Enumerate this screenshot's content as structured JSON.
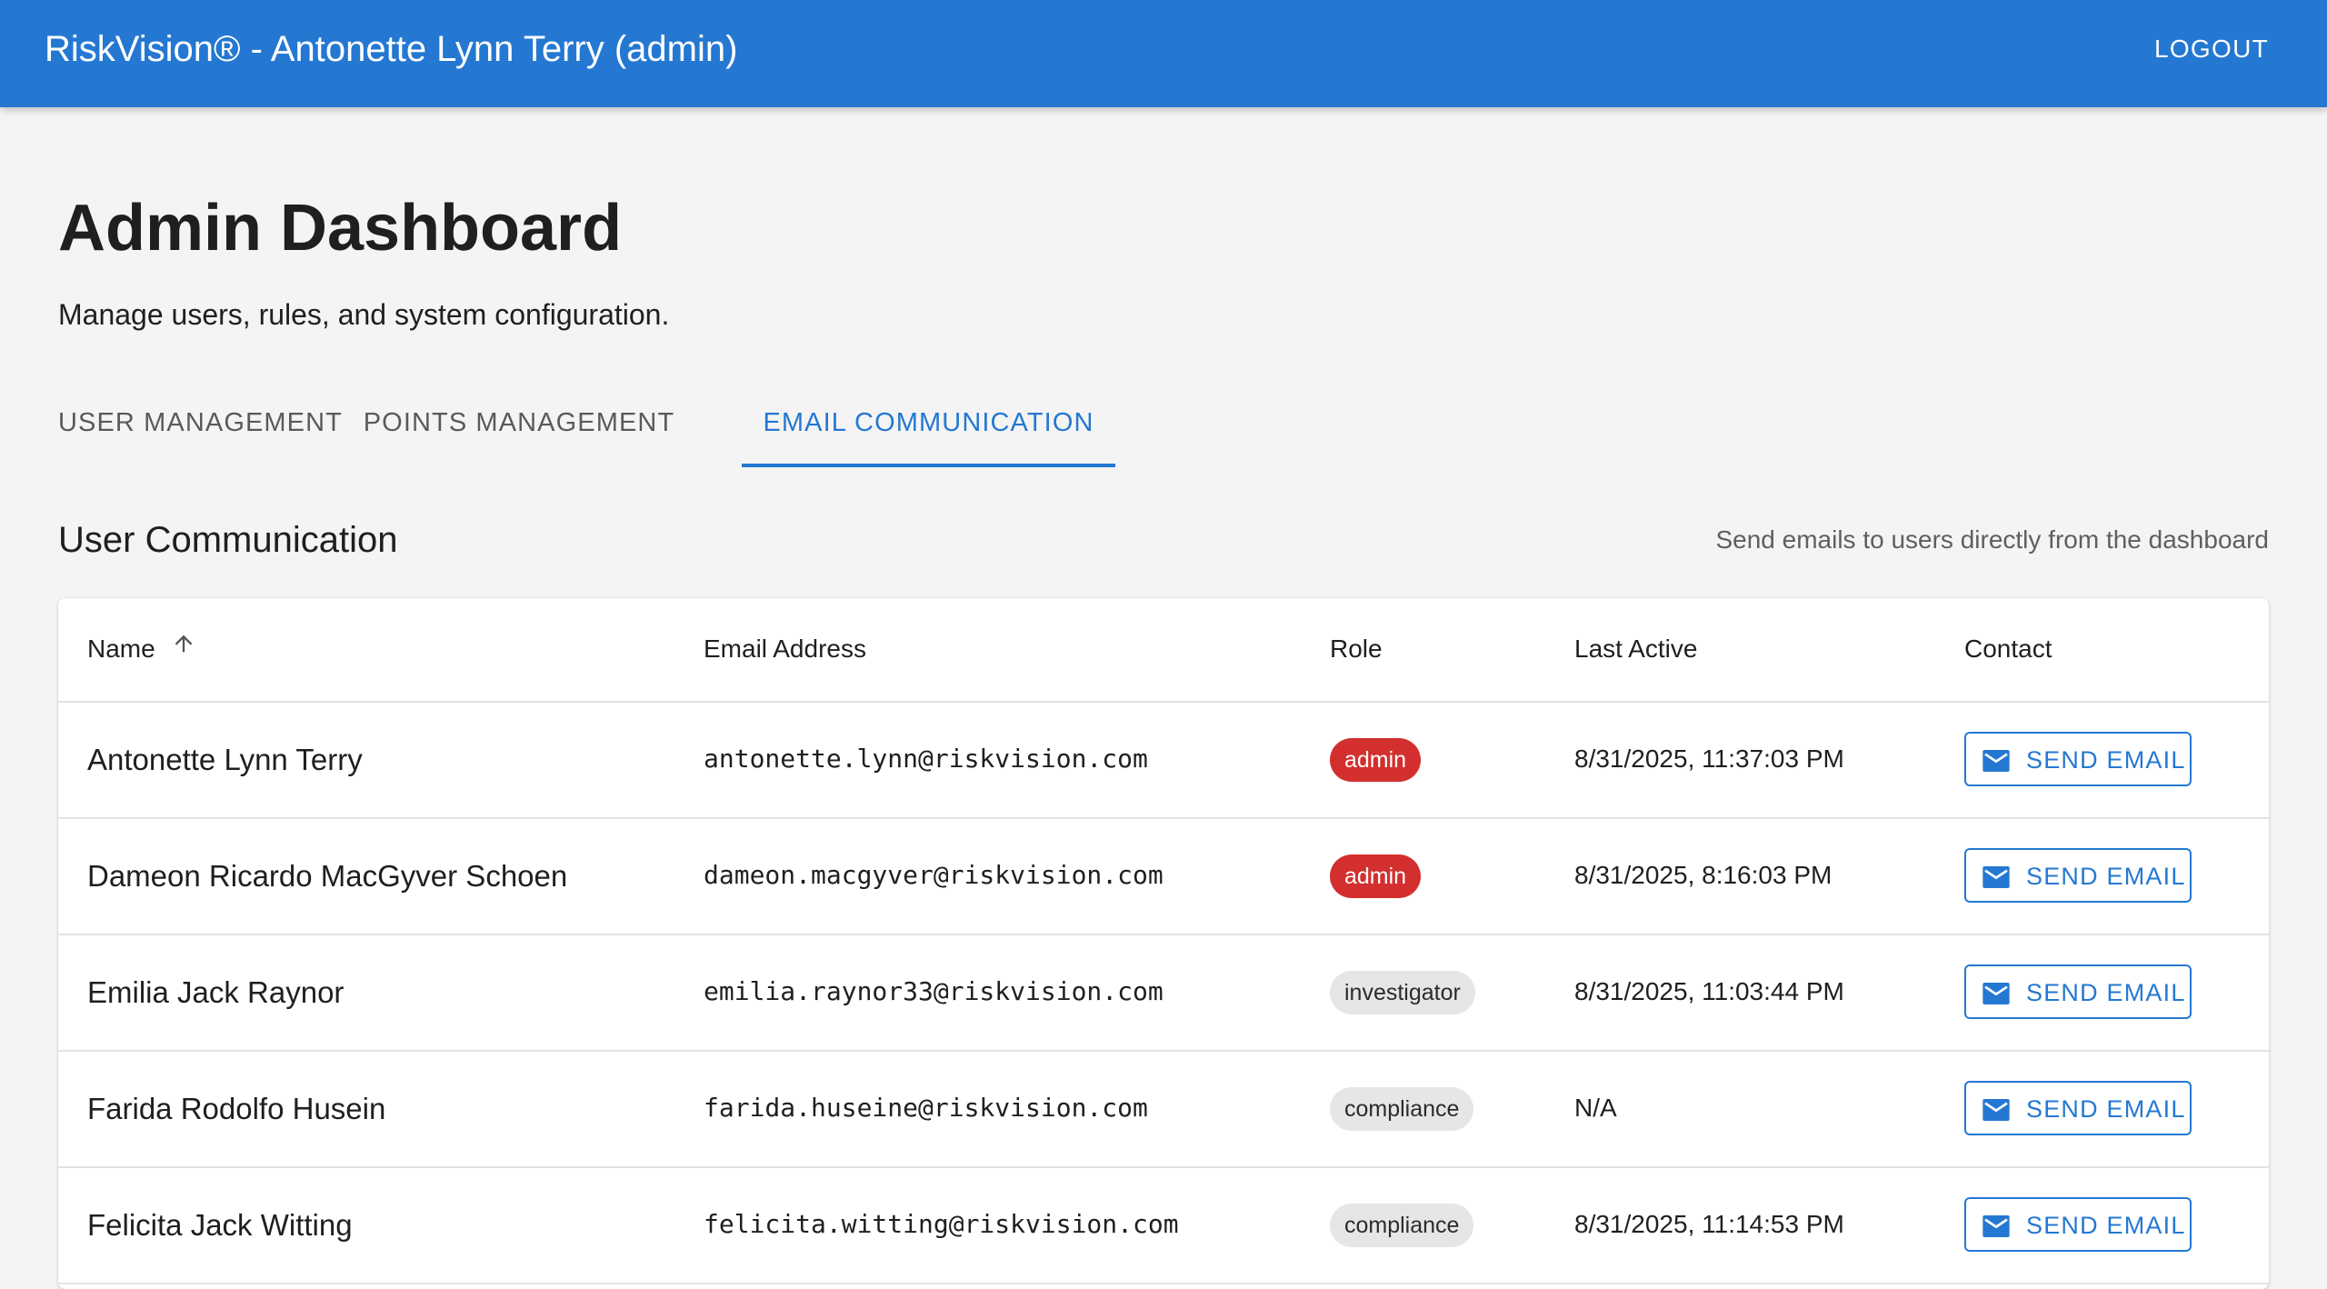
{
  "app": {
    "title": "RiskVision® - Antonette Lynn Terry (admin)",
    "logout_label": "LOGOUT",
    "brand_color": "#2478d2"
  },
  "page": {
    "title": "Admin Dashboard",
    "subtitle": "Manage users, rules, and system configuration."
  },
  "tabs": [
    {
      "label": "USER MANAGEMENT",
      "active": false
    },
    {
      "label": "POINTS MANAGEMENT",
      "active": false
    },
    {
      "label": "EMAIL COMMUNICATION",
      "active": true
    }
  ],
  "section": {
    "title": "User Communication",
    "caption": "Send emails to users directly from the dashboard"
  },
  "table": {
    "columns": {
      "name": "Name",
      "email": "Email Address",
      "role": "Role",
      "last_active": "Last Active",
      "contact": "Contact"
    },
    "sort": {
      "column": "name",
      "direction": "ascending",
      "icon": "arrow-up-icon"
    },
    "button_label": "SEND EMAIL",
    "button_icon": "mail-icon",
    "rows": [
      {
        "name": "Antonette Lynn Terry",
        "email": "antonette.lynn@riskvision.com",
        "role": "admin",
        "last_active": "8/31/2025, 11:37:03 PM"
      },
      {
        "name": "Dameon Ricardo MacGyver Schoen",
        "email": "dameon.macgyver@riskvision.com",
        "role": "admin",
        "last_active": "8/31/2025, 8:16:03 PM"
      },
      {
        "name": "Emilia Jack Raynor",
        "email": "emilia.raynor33@riskvision.com",
        "role": "investigator",
        "last_active": "8/31/2025, 11:03:44 PM"
      },
      {
        "name": "Farida Rodolfo Husein",
        "email": "farida.huseine@riskvision.com",
        "role": "compliance",
        "last_active": "N/A"
      },
      {
        "name": "Felicita Jack Witting",
        "email": "felicita.witting@riskvision.com",
        "role": "compliance",
        "last_active": "8/31/2025, 11:14:53 PM"
      }
    ],
    "role_colors": {
      "admin": "#d32f2f",
      "other": "#e6e6e6"
    }
  }
}
